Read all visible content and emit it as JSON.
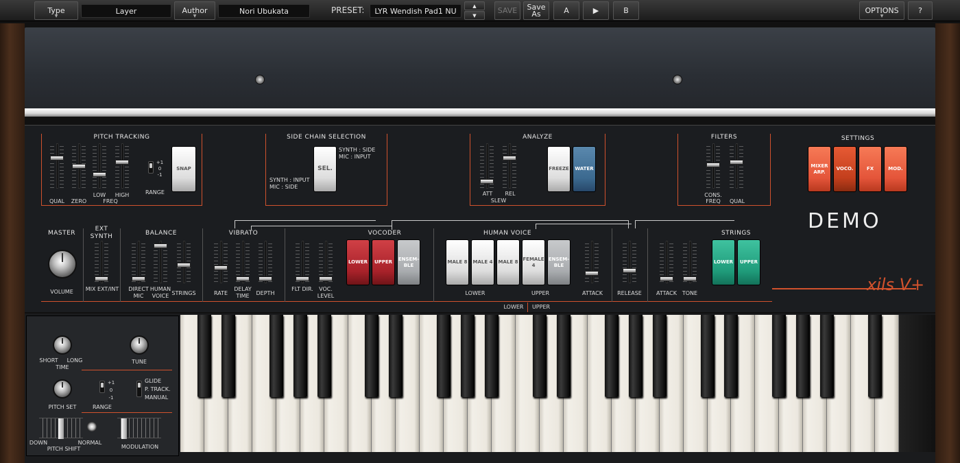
{
  "topbar": {
    "type": "Type",
    "layer": "Layer",
    "author": "Author",
    "author_name": "Nori Ubukata",
    "preset_label": "PRESET:",
    "preset_name": "LYR Wendish Pad1 NU",
    "save": "SAVE",
    "save_as": "Save As",
    "a": "A",
    "play": "▶",
    "b": "B",
    "options": "OPTIONS",
    "help": "?"
  },
  "pitch_tracking": {
    "title": "PITCH TRACKING",
    "qual": "QUAL",
    "zero": "ZERO",
    "low": "LOW",
    "high": "HIGH",
    "freq": "FREQ",
    "range": "RANGE",
    "p1": "+1",
    "p0": "0",
    "m1": "-1",
    "snap": "SNAP"
  },
  "side_chain": {
    "title": "SIDE CHAIN SELECTION",
    "sel": "SEL.",
    "opt1a": "SYNTH : SIDE",
    "opt1b": "MIC    : INPUT",
    "opt2a": "SYNTH : INPUT",
    "opt2b": "MIC    : SIDE"
  },
  "analyze": {
    "title": "ANALYZE",
    "att": "ATT",
    "rel": "REL",
    "slew": "SLEW",
    "freeze": "FREEZE",
    "water": "WATER"
  },
  "filters": {
    "title": "FILTERS",
    "cons": "CONS.",
    "freq": "FREQ",
    "qual": "QUAL"
  },
  "settings": {
    "title": "SETTINGS",
    "mixer": "MIXER ARP.",
    "voco": "VOCO.",
    "fx": "FX",
    "mod": "MOD."
  },
  "demo": "DEMO",
  "logo": "xils V+",
  "master": {
    "title": "MASTER",
    "volume": "VOLUME"
  },
  "ext_synth": {
    "title": "EXT SYNTH",
    "mix": "MIX EXT/INT"
  },
  "balance": {
    "title": "BALANCE",
    "direct": "DIRECT MIC",
    "human": "HUMAN VOICE",
    "strings": "STRINGS"
  },
  "vibrato": {
    "title": "VIBRATO",
    "rate": "RATE",
    "delay": "DELAY TIME",
    "depth": "DEPTH"
  },
  "vocoder": {
    "title": "VOCODER",
    "flt": "FLT DIR.",
    "voc": "VOC. LEVEL",
    "lower": "LOWER",
    "upper": "UPPER",
    "ensemble": "ENSEM-BLE"
  },
  "human_voice": {
    "title": "HUMAN VOICE",
    "male8a": "MALE 8",
    "male4": "MALE 4",
    "male8b": "MALE 8",
    "female4": "FEMALE 4",
    "ensemble": "ENSEM-BLE",
    "lower": "LOWER",
    "upper": "UPPER",
    "attack": "ATTACK"
  },
  "release": "RELEASE",
  "strings": {
    "title": "STRINGS",
    "attack": "ATTACK",
    "tone": "TONE",
    "lower": "LOWER",
    "upper": "UPPER"
  },
  "lower_upper": {
    "lower": "LOWER",
    "upper": "UPPER"
  },
  "leftctl": {
    "short": "SHORT",
    "long": "LONG",
    "time": "TIME",
    "tune": "TUNE",
    "pitch_set": "PITCH SET",
    "range": "RANGE",
    "p1": "+1",
    "p0": "0",
    "m1": "-1",
    "glide": "GLIDE",
    "ptrack": "P. TRACK.",
    "manual": "MANUAL",
    "down": "DOWN",
    "normal": "NORMAL",
    "pitch_shift": "PITCH SHIFT",
    "modulation": "MODULATION"
  }
}
